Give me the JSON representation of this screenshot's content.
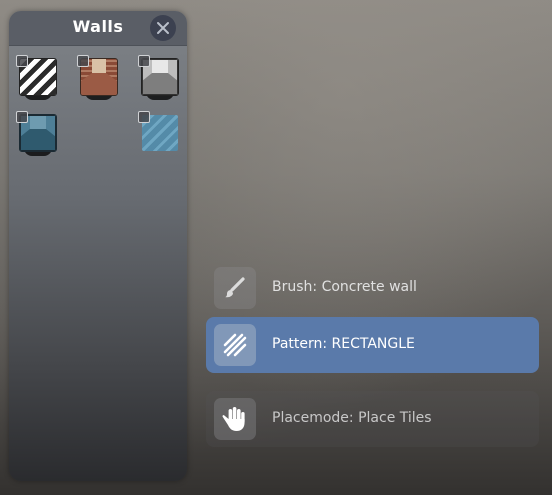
{
  "panel": {
    "title": "Walls",
    "close_icon": "close-icon",
    "tiles": [
      {
        "icon": "striped-wall-tile",
        "checked": false
      },
      {
        "icon": "brick-corridor-tile",
        "checked": false
      },
      {
        "icon": "gray-corridor-tile",
        "checked": false
      },
      {
        "icon": "blue-corridor-tile",
        "checked": false
      },
      {
        "icon": "blue-glass-tile",
        "checked": false
      }
    ]
  },
  "toolbar": {
    "brush": {
      "icon": "brush-icon",
      "label": "Brush: Concrete wall",
      "selected": false
    },
    "pattern": {
      "icon": "hatch-pattern-icon",
      "label": "Pattern: RECTANGLE",
      "selected": true
    },
    "placemode": {
      "icon": "hand-icon",
      "label": "Placemode: Place Tiles",
      "selected": false
    }
  },
  "colors": {
    "selected_row": "#5a7aaa",
    "panel_header": "#5a5e66",
    "close_button": "#3c4150"
  }
}
